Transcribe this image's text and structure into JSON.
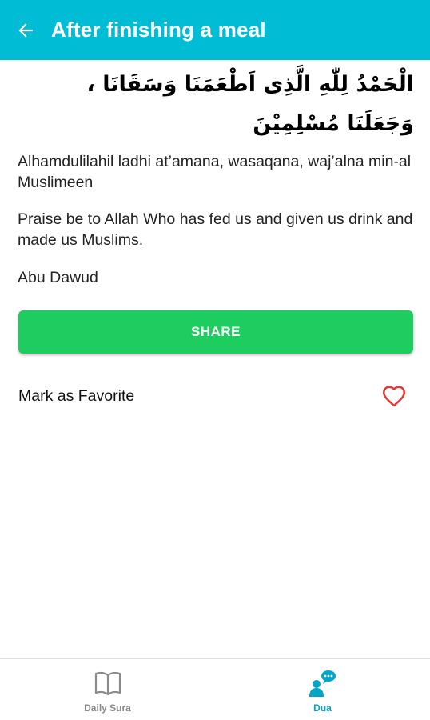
{
  "colors": {
    "appbar": "#00bcd4",
    "share_button": "#1fcc5f",
    "heart": "#e53935",
    "nav_active": "#00a5c8",
    "nav_inactive": "#888888"
  },
  "appbar": {
    "back_icon": "arrow-left-icon",
    "title": "After finishing a meal"
  },
  "dua": {
    "arabic": "الْحَمْدُ لِلّٰهِ الَّذِى اَطْعَمَنَا وَسَقَانَا ، وَجَعَلَنَا مُسْلِمِيْنَ",
    "transliteration": "Alhamdulilahil ladhi at’amana, wasaqana, waj’alna min-al Muslimeen",
    "translation": "Praise be to Allah Who has fed us and given us drink and made us Muslims.",
    "source": "Abu Dawud"
  },
  "actions": {
    "share_label": "SHARE",
    "favorite_label": "Mark as Favorite",
    "favorite_icon": "heart-outline-icon"
  },
  "bottom_nav": {
    "items": [
      {
        "label": "Daily Sura",
        "icon": "book-icon",
        "active": false
      },
      {
        "label": "Dua",
        "icon": "praying-person-icon",
        "active": true
      }
    ]
  }
}
